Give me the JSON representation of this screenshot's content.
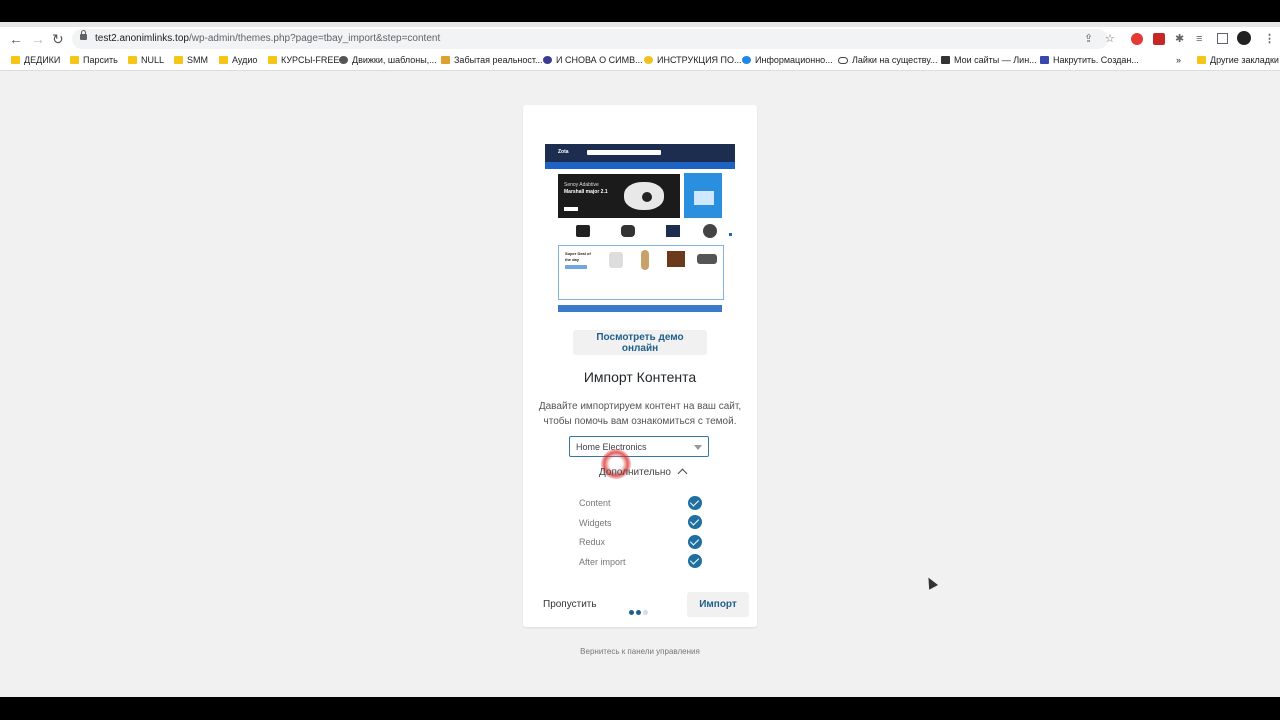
{
  "browser": {
    "url_host": "test2.anonimlinks.top",
    "url_path": "/wp-admin/themes.php?page=tbay_import&step=content",
    "bookmarks": [
      {
        "label": "ДЕДИКИ",
        "icon": "folder-icon"
      },
      {
        "label": "Парсить",
        "icon": "folder-icon"
      },
      {
        "label": "NULL",
        "icon": "folder-icon"
      },
      {
        "label": "SMM",
        "icon": "folder-icon"
      },
      {
        "label": "Аудио",
        "icon": "folder-icon"
      },
      {
        "label": "КУРСЫ-FREE",
        "icon": "folder-icon"
      },
      {
        "label": "Движки, шаблоны,...",
        "icon": "site-icon"
      },
      {
        "label": "Забытая реальност...",
        "icon": "site-icon"
      },
      {
        "label": "И СНОВА О СИМВ...",
        "icon": "site-icon"
      },
      {
        "label": "ИНСТРУКЦИЯ ПО...",
        "icon": "site-icon"
      },
      {
        "label": "Информационно...",
        "icon": "site-icon"
      },
      {
        "label": "Лайки на существу...",
        "icon": "site-icon"
      },
      {
        "label": "Мои сайты — Лин...",
        "icon": "site-icon"
      },
      {
        "label": "Накрутить. Создан...",
        "icon": "site-icon"
      }
    ],
    "other_bookmarks": "Другие закладки",
    "more_bookmarks": "»"
  },
  "wizard": {
    "demo_button": "Посмотреть демо онлайн",
    "title": "Импорт Контента",
    "description_line1": "Давайте импортируем контент на ваш сайт,",
    "description_line2": "чтобы помочь вам ознакомиться с темой.",
    "selected_demo": "Home Electronics",
    "advanced_toggle": "Дополнительно",
    "options": [
      {
        "label": "Content",
        "checked": true
      },
      {
        "label": "Widgets",
        "checked": true
      },
      {
        "label": "Redux",
        "checked": true
      },
      {
        "label": "After import",
        "checked": true
      }
    ],
    "skip_label": "Пропустить",
    "import_label": "Импорт",
    "step_total": 3,
    "step_current": 2,
    "back_link": "Вернитесь к панели управления"
  },
  "preview": {
    "brand": "Zota",
    "hero_line1": "Senoy Adabtive",
    "hero_line2": "Marshall major 2.1",
    "deal_line1": "Super Deal of",
    "deal_line2": "the day"
  },
  "colors": {
    "accent": "#1f6fa1",
    "link_text": "#1f5f8b",
    "page_bg": "#f1f1f1",
    "select_border": "#3377a8"
  }
}
